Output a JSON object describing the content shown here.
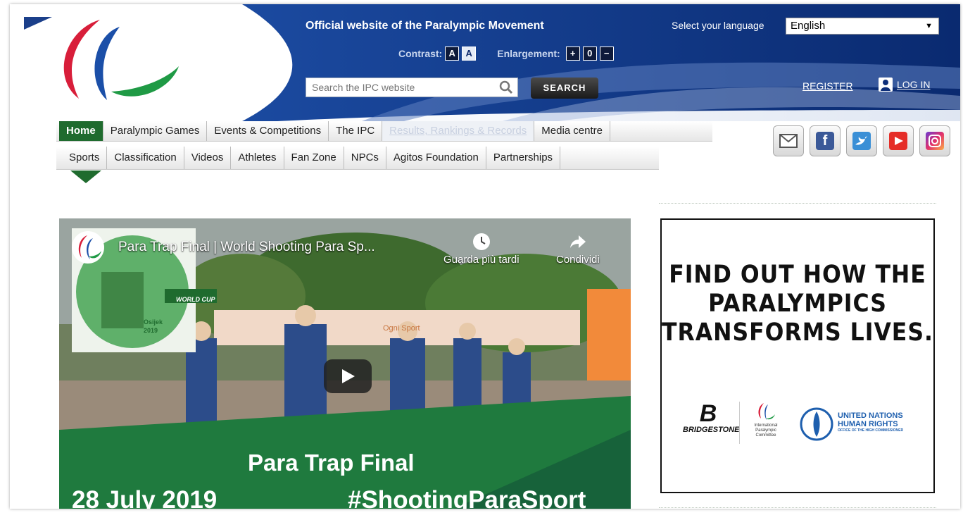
{
  "header": {
    "tagline": "Official website of the Paralympic Movement",
    "contrast_label": "Contrast:",
    "contrast_a_dark": "A",
    "contrast_a_light": "A",
    "enlargement_label": "Enlargement:",
    "enlarge_plus": "+",
    "enlarge_zero": "0",
    "enlarge_minus": "−",
    "search_placeholder": "Search the IPC website",
    "search_button": "SEARCH",
    "language_label": "Select your language",
    "language_value": "English",
    "register": "REGISTER",
    "login": "LOG IN"
  },
  "nav_primary": [
    {
      "label": "Home"
    },
    {
      "label": "Paralympic Games"
    },
    {
      "label": "Events & Competitions"
    },
    {
      "label": "The IPC"
    },
    {
      "label": "Results, Rankings & Records"
    },
    {
      "label": "Media centre"
    }
  ],
  "nav_secondary": [
    {
      "label": "Sports"
    },
    {
      "label": "Classification"
    },
    {
      "label": "Videos"
    },
    {
      "label": "Athletes"
    },
    {
      "label": "Fan Zone"
    },
    {
      "label": "NPCs"
    },
    {
      "label": "Agitos Foundation"
    },
    {
      "label": "Partnerships"
    }
  ],
  "social": [
    "email-icon",
    "facebook-icon",
    "twitter-icon",
    "youtube-icon",
    "instagram-icon"
  ],
  "video": {
    "title": "Para Trap Final | World Shooting Para Sp...",
    "watch_later": "Guarda più tardi",
    "share": "Condividi",
    "overlay_title": "Para Trap Final",
    "overlay_date": "28 July 2019",
    "overlay_hashtag": "#ShootingParaSport",
    "thumb_world_cup": "WORLD CUP",
    "thumb_city": "Osijek",
    "thumb_year": "2019",
    "banner_sign": "Ogni Sport"
  },
  "ad": {
    "line1": "FIND OUT HOW THE",
    "line2": "PARALYMPICS",
    "line3": "TRANSFORMS LIVES.",
    "sponsor1": "BRIDGESTONE",
    "sponsor2_l1": "International",
    "sponsor2_l2": "Paralympic",
    "sponsor2_l3": "Committee",
    "un_l1": "UNITED NATIONS",
    "un_l2": "HUMAN RIGHTS",
    "un_l3": "OFFICE OF THE HIGH COMMISSIONER"
  },
  "colors": {
    "banner_blue": "#0e2f7a",
    "nav_green": "#1f6b2e",
    "agitos_red": "#d81e3a",
    "agitos_blue": "#1b4fa8",
    "agitos_green": "#1f9a45"
  }
}
